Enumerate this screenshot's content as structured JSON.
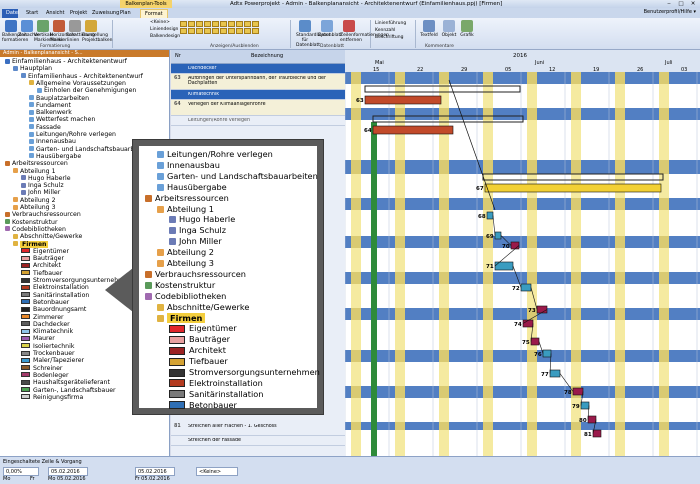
{
  "window": {
    "context_tab": "Balkenplan-Tools",
    "title": "Adtx Powerprojekt - Admin - Balkenplanansicht - Architektenentwurf (Einfamilienhaus.ppj) [Firmen]",
    "controls": [
      "‒",
      "□",
      "✕"
    ]
  },
  "menu_tabs": [
    "Datei",
    "Start",
    "Ansicht",
    "Projekt",
    "Zuweisung",
    "Plan",
    "Format"
  ],
  "help_label": "Benutzerprofil/Hilfe ▾",
  "ribbon": {
    "buttons": [
      {
        "label": "Balkenplan formatieren",
        "icon": "balkenplan-icon",
        "color": "#3f74c4"
      },
      {
        "label": "Zeitachse",
        "icon": "timeline-icon",
        "color": "#5a8fd6"
      },
      {
        "label": "Vertikale Markierlinien",
        "icon": "vertical-lines-icon",
        "color": "#6aa36a"
      },
      {
        "label": "Horizontale Markierlinien",
        "icon": "horizontal-lines-icon",
        "color": "#c25c3a"
      },
      {
        "label": "Schattierung",
        "icon": "shading-icon",
        "color": "#999999"
      },
      {
        "label": "Darstellung Projektbalken",
        "icon": "project-bar-icon",
        "color": "#d3a73a"
      },
      {
        "label": "Standardlayout für Datenblatt",
        "icon": "layout-icon",
        "color": "#5b8cc9"
      },
      {
        "label": "Datenblatt",
        "icon": "datasheet-icon",
        "color": "#7ca5d9"
      },
      {
        "label": "Zeilenformatierungen entfernen",
        "icon": "remove-format-icon",
        "color": "#c94b4b"
      },
      {
        "label": "Textfeld",
        "icon": "textbox-icon",
        "color": "#6d8fc3"
      },
      {
        "label": "Objekt",
        "icon": "object-icon",
        "color": "#9bb2d6"
      },
      {
        "label": "Grafik",
        "icon": "graphic-icon",
        "color": "#7aa86a"
      }
    ],
    "dropdowns": [
      "<Keine>",
      "Liniendesign",
      "Balkendesign"
    ],
    "small_items": [
      "Linienführung",
      "Kennzahl",
      "Beschriftung"
    ],
    "groups": [
      "Formatierung",
      "Anzeigen/Ausblenden",
      "Datenblatt",
      "Kommentare"
    ]
  },
  "left_pane": {
    "header": "Admin - Balkenplanansicht - S...",
    "tree": [
      {
        "label": "Einfamilienhaus - Architektenentwurf",
        "indent": 0,
        "icon": "project-icon",
        "kind": "node"
      },
      {
        "label": "Hauptplan",
        "indent": 1,
        "icon": "plan-icon",
        "kind": "node"
      },
      {
        "label": "Einfamilienhaus - Architektenentwurf",
        "indent": 2,
        "icon": "plan-icon",
        "kind": "node"
      },
      {
        "label": "Allgemeine Voraussetzungen",
        "indent": 3,
        "icon": "folder-icon",
        "kind": "node"
      },
      {
        "label": "Einholen der Genehmigungen",
        "indent": 4,
        "icon": "task-icon",
        "kind": "node"
      },
      {
        "label": "Bauplatzarbeiten",
        "indent": 3,
        "icon": "task-icon",
        "kind": "node"
      },
      {
        "label": "Fundament",
        "indent": 3,
        "icon": "task-icon",
        "kind": "node"
      },
      {
        "label": "Balkenwerk",
        "indent": 3,
        "icon": "task-icon",
        "kind": "node"
      },
      {
        "label": "Wetterfest machen",
        "indent": 3,
        "icon": "task-icon",
        "kind": "node"
      },
      {
        "label": "Fassade",
        "indent": 3,
        "icon": "task-icon",
        "kind": "node"
      },
      {
        "label": "Leitungen/Rohre verlegen",
        "indent": 3,
        "icon": "task-icon",
        "kind": "node"
      },
      {
        "label": "Innenausbau",
        "indent": 3,
        "icon": "task-icon",
        "kind": "node"
      },
      {
        "label": "Garten- und Landschaftsbauarbeiten",
        "indent": 3,
        "icon": "task-icon",
        "kind": "node"
      },
      {
        "label": "Hausübergabe",
        "indent": 3,
        "icon": "task-icon",
        "kind": "node"
      },
      {
        "label": "Arbeitsressourcen",
        "indent": 0,
        "icon": "resource-icon",
        "kind": "node"
      },
      {
        "label": "Abteilung 1",
        "indent": 1,
        "icon": "group-icon",
        "kind": "node"
      },
      {
        "label": "Hugo Haberle",
        "indent": 2,
        "icon": "person-icon",
        "kind": "node"
      },
      {
        "label": "Inga Schulz",
        "indent": 2,
        "icon": "person-icon",
        "kind": "node"
      },
      {
        "label": "John Miller",
        "indent": 2,
        "icon": "person-icon",
        "kind": "node"
      },
      {
        "label": "Abteilung 2",
        "indent": 1,
        "icon": "group-icon",
        "kind": "node"
      },
      {
        "label": "Abteilung 3",
        "indent": 1,
        "icon": "group-icon",
        "kind": "node"
      },
      {
        "label": "Verbrauchsressourcen",
        "indent": 0,
        "icon": "resource-icon",
        "kind": "node"
      },
      {
        "label": "Kostenstruktur",
        "indent": 0,
        "icon": "cost-icon",
        "kind": "node"
      },
      {
        "label": "Codebibliotheken",
        "indent": 0,
        "icon": "library-icon",
        "kind": "node"
      },
      {
        "label": "Abschnitte/Gewerke",
        "indent": 1,
        "icon": "folder-icon",
        "kind": "node"
      },
      {
        "label": "Firmen",
        "indent": 1,
        "icon": "folder-icon",
        "kind": "selected"
      },
      {
        "label": "Eigentümer",
        "indent": 2,
        "swatch": "#e0262b",
        "kind": "code"
      },
      {
        "label": "Bauträger",
        "indent": 2,
        "swatch": "#e8a0a0",
        "kind": "code"
      },
      {
        "label": "Architekt",
        "indent": 2,
        "swatch": "#9b2222",
        "kind": "code"
      },
      {
        "label": "Tiefbauer",
        "indent": 2,
        "swatch": "#d4a233",
        "kind": "code"
      },
      {
        "label": "Stromversorgungsunternehmen",
        "indent": 2,
        "swatch": "#333333",
        "kind": "code"
      },
      {
        "label": "Elektroinstallation",
        "indent": 2,
        "swatch": "#b33a1f",
        "kind": "code"
      },
      {
        "label": "Sanitärinstallation",
        "indent": 2,
        "swatch": "#7a7a7a",
        "kind": "code"
      },
      {
        "label": "Betonbauer",
        "indent": 2,
        "swatch": "#2f6fb5",
        "kind": "code"
      },
      {
        "label": "Bauordnungsamt",
        "indent": 2,
        "swatch": "#222222",
        "kind": "code"
      },
      {
        "label": "Zimmerer",
        "indent": 2,
        "swatch": "#e98a2c",
        "kind": "code"
      },
      {
        "label": "Dachdecker",
        "indent": 2,
        "swatch": "#5d5d5d",
        "kind": "code"
      },
      {
        "label": "Klimatechnik",
        "indent": 2,
        "swatch": "#8fc4e8",
        "kind": "code"
      },
      {
        "label": "Maurer",
        "indent": 2,
        "swatch": "#9c5cae",
        "kind": "code"
      },
      {
        "label": "Isoliertechnik",
        "indent": 2,
        "swatch": "#d9d34c",
        "kind": "code"
      },
      {
        "label": "Trockenbauer",
        "indent": 2,
        "swatch": "#888888",
        "kind": "code"
      },
      {
        "label": "Maler/Tapezierer",
        "indent": 2,
        "swatch": "#3c9bd1",
        "kind": "code"
      },
      {
        "label": "Schreiner",
        "indent": 2,
        "swatch": "#8a5a2a",
        "kind": "code"
      },
      {
        "label": "Bodenleger",
        "indent": 2,
        "swatch": "#a33a6a",
        "kind": "code"
      },
      {
        "label": "Haushaltsgerätelieferant",
        "indent": 2,
        "swatch": "#4a4a4a",
        "kind": "code"
      },
      {
        "label": "Garten-, Landschaftsbauer",
        "indent": 2,
        "swatch": "#4da052",
        "kind": "code"
      },
      {
        "label": "Reinigungsfirma",
        "indent": 2,
        "swatch": "#cfcfcf",
        "kind": "code"
      }
    ]
  },
  "grid": {
    "col_nr": "Nr",
    "col_desc": "Bezeichnung",
    "rows": [
      {
        "num": "",
        "desc": "Dachdecker",
        "color": "#2a63b8",
        "text": "#ffffff",
        "h": 10
      },
      {
        "num": "63",
        "desc": "Aufbringen der Unterspannbahn, der Traufbleche und der Dachplatten",
        "color": "#f4f0d8",
        "text": "#000000",
        "h": 16
      },
      {
        "num": "",
        "desc": "Klimatechnik",
        "color": "#2a63b8",
        "text": "#ffffff",
        "h": 10
      },
      {
        "num": "64",
        "desc": "Verlegen der Klimaanlagenrohre",
        "color": "#f4f0d8",
        "text": "#000000",
        "h": 16
      },
      {
        "num": "",
        "desc": "Leitungen/Rohre verlegen",
        "color": "#e9eef7",
        "text": "#555555",
        "h": 10
      },
      {
        "num": "81",
        "desc": "Streichen aller Flächen - 1. Geschoss",
        "color": "#e9eef7",
        "text": "#000000",
        "h": 14
      },
      {
        "num": "",
        "desc": "Streichen der Fassade",
        "color": "#e9eef7",
        "text": "#000000",
        "h": 10
      }
    ]
  },
  "gantt": {
    "year": "2016",
    "months": [
      "Mai",
      "Juni",
      "Juli"
    ],
    "days": [
      "15",
      "22",
      "29",
      "05",
      "12",
      "19",
      "26",
      "03"
    ],
    "bars": [
      {
        "label": "63",
        "color": "#c24a2a"
      },
      {
        "label": "64",
        "color": "#c24a2a"
      },
      {
        "label": "67",
        "color": "#f2d034"
      },
      {
        "label": "68",
        "color": "#3a9cc0"
      },
      {
        "label": "69",
        "color": "#3a9cc0"
      },
      {
        "label": "70",
        "color": "#9a1a4a"
      },
      {
        "label": "71",
        "color": "#3a9cc0"
      },
      {
        "label": "72",
        "color": "#3a9cc0"
      },
      {
        "label": "73",
        "color": "#9a1a4a"
      },
      {
        "label": "74",
        "color": "#9a1a4a"
      },
      {
        "label": "75",
        "color": "#9a1a4a"
      },
      {
        "label": "76",
        "color": "#3a9cc0"
      },
      {
        "label": "77",
        "color": "#3a9cc0"
      },
      {
        "label": "78",
        "color": "#9a1a4a"
      },
      {
        "label": "79",
        "color": "#3a9cc0"
      },
      {
        "label": "80",
        "color": "#9a1a4a"
      },
      {
        "label": "81",
        "color": "#9a1a4a"
      }
    ]
  },
  "statusbar": {
    "label": "Eingeschaltete Zeile & Vorgang",
    "fields": [
      "0,00%",
      "05.02.2016",
      "05.02.2016",
      "<Keine>"
    ],
    "texts": [
      "Mo",
      "Fr",
      "Mo 05.02.2016",
      "Fr 05.02.2016"
    ]
  },
  "callout": {
    "items": [
      {
        "label": "Leitungen/Rohre verlegen",
        "icon": "task-icon",
        "indent": 1
      },
      {
        "label": "Innenausbau",
        "icon": "task-icon",
        "indent": 1
      },
      {
        "label": "Garten- und Landschaftsbauarbeiten",
        "icon": "task-icon",
        "indent": 1
      },
      {
        "label": "Hausübergabe",
        "icon": "task-icon",
        "indent": 1
      },
      {
        "label": "Arbeitsressourcen",
        "icon": "resource-icon",
        "indent": 0
      },
      {
        "label": "Abteilung 1",
        "icon": "group-icon",
        "indent": 1
      },
      {
        "label": "Hugo Haberle",
        "icon": "person-icon",
        "indent": 2
      },
      {
        "label": "Inga Schulz",
        "icon": "person-icon",
        "indent": 2
      },
      {
        "label": "John Miller",
        "icon": "person-icon",
        "indent": 2
      },
      {
        "label": "Abteilung 2",
        "icon": "group-icon",
        "indent": 1
      },
      {
        "label": "Abteilung 3",
        "icon": "group-icon",
        "indent": 1
      },
      {
        "label": "Verbrauchsressourcen",
        "icon": "resource-icon",
        "indent": 0
      },
      {
        "label": "Kostenstruktur",
        "icon": "cost-icon",
        "indent": 0
      },
      {
        "label": "Codebibliotheken",
        "icon": "library-icon",
        "indent": 0
      },
      {
        "label": "Abschnitte/Gewerke",
        "icon": "folder-icon",
        "indent": 1
      },
      {
        "label": "Firmen",
        "icon": "folder-icon",
        "indent": 1,
        "selected": true
      },
      {
        "label": "Eigentümer",
        "swatch": "#e0262b",
        "indent": 2
      },
      {
        "label": "Bauträger",
        "swatch": "#e8a0a0",
        "indent": 2
      },
      {
        "label": "Architekt",
        "swatch": "#9b2222",
        "indent": 2
      },
      {
        "label": "Tiefbauer",
        "swatch": "#d4a233",
        "indent": 2
      },
      {
        "label": "Stromversorgungsunternehmen",
        "swatch": "#333333",
        "indent": 2
      },
      {
        "label": "Elektroinstallation",
        "swatch": "#b33a1f",
        "indent": 2
      },
      {
        "label": "Sanitärinstallation",
        "swatch": "#7a7a7a",
        "indent": 2
      },
      {
        "label": "Betonbauer",
        "swatch": "#2f6fb5",
        "indent": 2
      }
    ]
  },
  "colors": {
    "stripe_blue": "#3469b8",
    "stripe_yellow": "#f5eaa0",
    "milestone_green": "#2e8b3a"
  }
}
